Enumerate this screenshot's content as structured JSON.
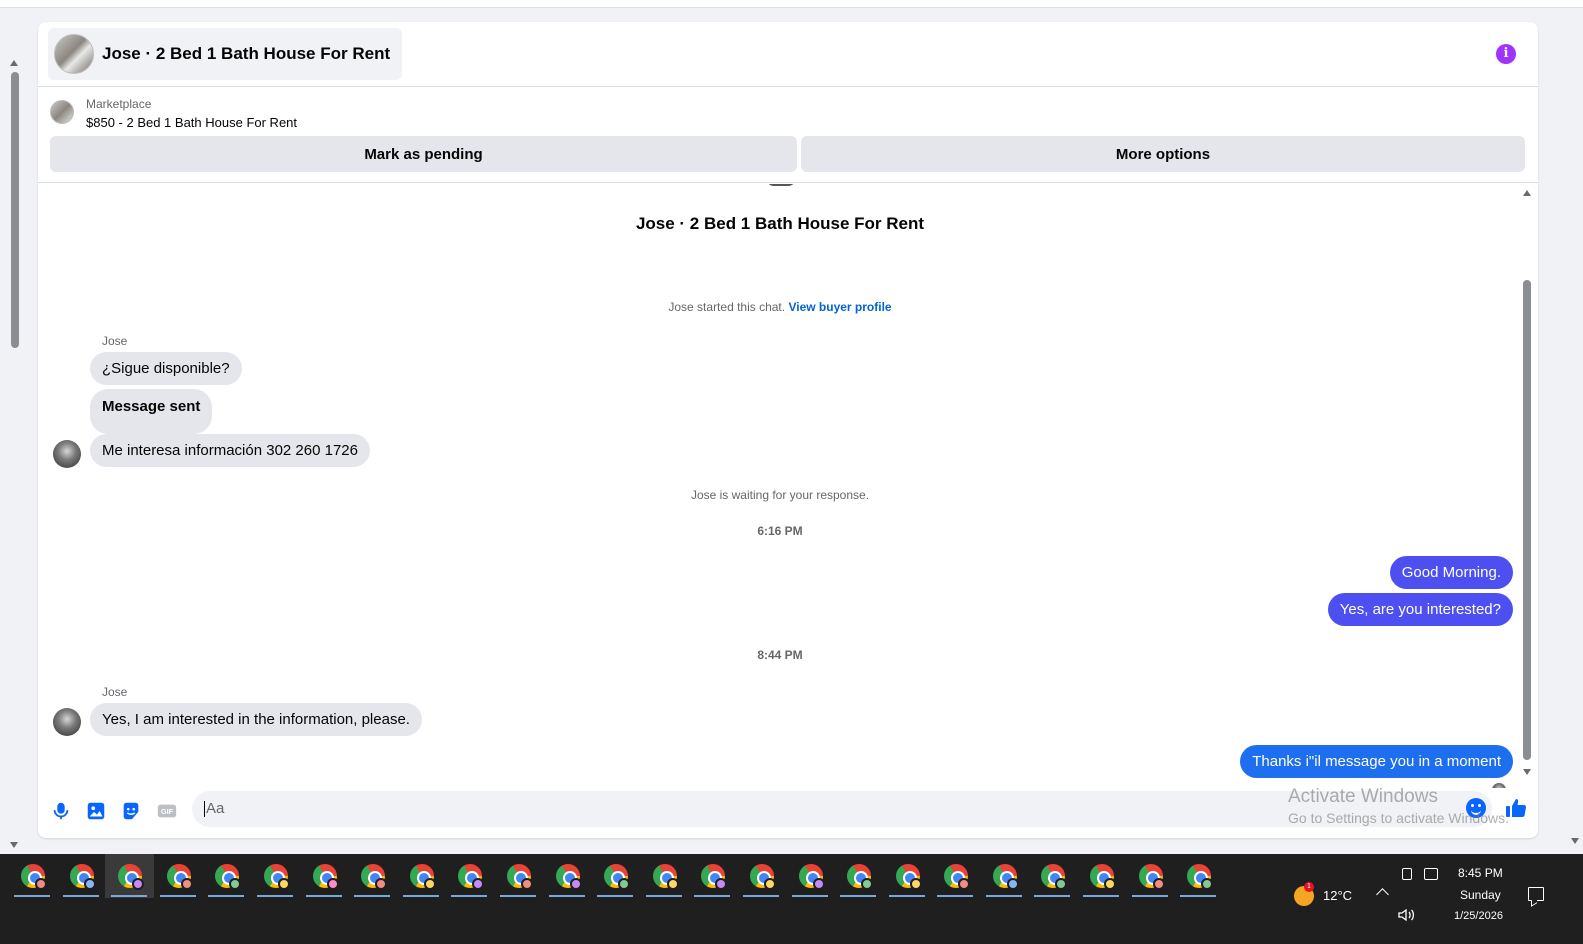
{
  "header": {
    "title": "Jose · 2 Bed 1 Bath House For Rent",
    "info_icon": "info-icon",
    "info_icon_color": "#a033ff"
  },
  "listing": {
    "category": "Marketplace",
    "title": "$850 - 2 Bed 1 Bath House For Rent",
    "buttons": {
      "mark_pending": "Mark as pending",
      "more_options": "More options"
    }
  },
  "conversation": {
    "title": "Jose · 2 Bed 1 Bath House For Rent",
    "started_text": "Jose started this chat.",
    "view_profile_link": "View buyer profile",
    "group1": {
      "sender": "Jose",
      "messages": [
        "¿Sigue disponible?",
        "Message sent",
        "Me interesa información  302 260 1726"
      ]
    },
    "waiting_notice": "Jose is waiting for your response.",
    "timestamp1": "6:16 PM",
    "outgoing1": [
      "Good Morning.",
      "Yes, are you interested?"
    ],
    "timestamp2": "8:44 PM",
    "group2": {
      "sender": "Jose",
      "messages": [
        "Yes, I am interested in the information, please."
      ]
    },
    "outgoing2": [
      "Thanks i\"il message you in a moment"
    ]
  },
  "composer": {
    "placeholder": "Aa",
    "icons": [
      "microphone-icon",
      "photo-icon",
      "sticker-icon",
      "gif-icon",
      "emoji-icon",
      "thumbs-up-icon"
    ],
    "gif_label": "GIF",
    "accent_color": "#0866ff"
  },
  "watermark": {
    "line1": "Activate Windows",
    "line2": "Go to Settings to activate Windows."
  },
  "taskbar": {
    "app_icon": "chrome-icon",
    "app_count": 25,
    "weather": {
      "temperature": "12°C",
      "badge": "1"
    },
    "clock": {
      "time": "8:45 PM",
      "day": "Sunday",
      "date": "1/25/2026"
    }
  },
  "colors": {
    "outgoing_violet": "#4d4ff0",
    "outgoing_blue": "#1e6ff0",
    "link": "#0064d1"
  }
}
